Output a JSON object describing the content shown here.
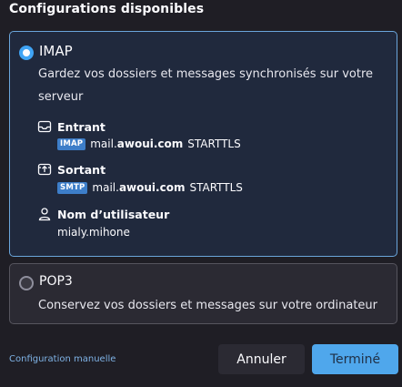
{
  "heading": "Configurations disponibles",
  "options": {
    "imap": {
      "title": "IMAP",
      "description": "Gardez vos dossiers et messages synchronisés sur votre serveur",
      "selected": true,
      "incoming": {
        "label": "Entrant",
        "badge": "IMAP",
        "host_prefix": "mail.",
        "host_domain": "awoui.com",
        "security": "STARTTLS"
      },
      "outgoing": {
        "label": "Sortant",
        "badge": "SMTP",
        "host_prefix": "mail.",
        "host_domain": "awoui.com",
        "security": "STARTTLS"
      },
      "username": {
        "label": "Nom d’utilisateur",
        "value": "mialy.mihone"
      }
    },
    "pop3": {
      "title": "POP3",
      "description": "Conservez vos dossiers et messages sur votre ordinateur",
      "selected": false
    }
  },
  "footer": {
    "manual_link": "Configuration manuelle",
    "cancel_label": "Annuler",
    "done_label": "Terminé"
  },
  "colors": {
    "accent": "#3fa4f5",
    "selected_border": "#6aa5db",
    "badge_bg": "#3d7ec9",
    "done_bg": "#4fa7ec"
  },
  "icons": {
    "incoming": "inbox-icon",
    "outgoing": "outbox-icon",
    "username": "user-icon"
  }
}
